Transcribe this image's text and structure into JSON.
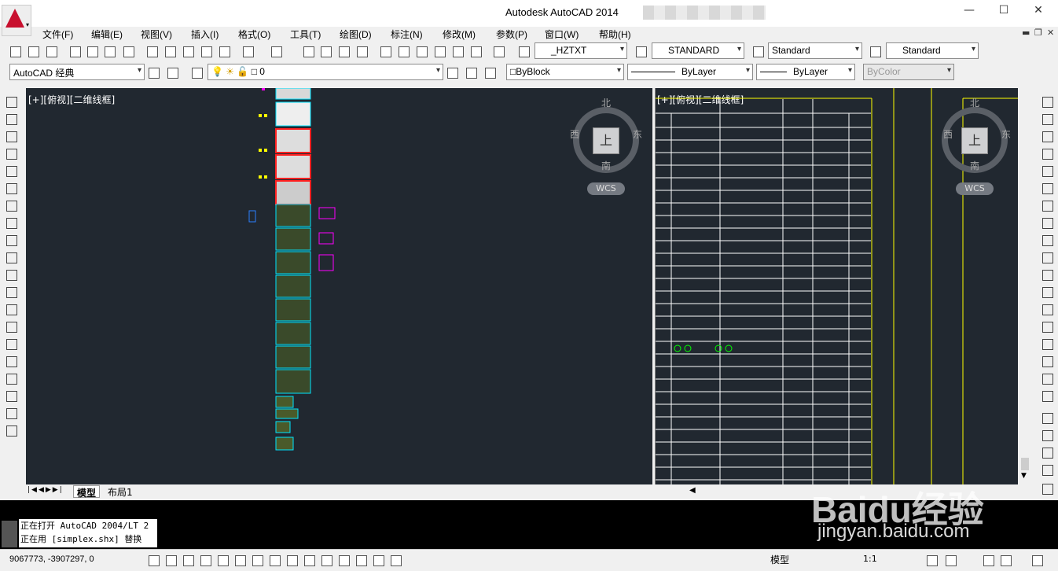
{
  "title": "Autodesk AutoCAD 2014",
  "menu": [
    "文件(F)",
    "编辑(E)",
    "视图(V)",
    "插入(I)",
    "格式(O)",
    "工具(T)",
    "绘图(D)",
    "标注(N)",
    "修改(M)",
    "参数(P)",
    "窗口(W)",
    "帮助(H)"
  ],
  "toolbar": {
    "text_style": "_HZTXT",
    "dim_style": "STANDARD",
    "table_style": "Standard",
    "mleader_style": "Standard",
    "workspace": "AutoCAD 经典",
    "layer": "0",
    "color": "ByBlock",
    "linetype": "ByLayer",
    "lineweight": "ByLayer",
    "plotstyle": "ByColor"
  },
  "viewport_left": {
    "label": "[+][俯视][二维线框]",
    "compass": {
      "north": "北",
      "south": "南",
      "east": "东",
      "west": "西",
      "face": "上",
      "wcs": "WCS"
    }
  },
  "viewport_right": {
    "label": "[+][俯视][二维线框]",
    "compass": {
      "north": "北",
      "south": "南",
      "east": "东",
      "west": "西",
      "face": "上",
      "wcs": "WCS"
    }
  },
  "tabs": [
    "模型",
    "布局1"
  ],
  "command_lines": [
    "正在打开 AutoCAD 2004/LT 2",
    "正在用 [simplex.shx] 替换"
  ],
  "status": {
    "coords": "9067773, -3907297, 0",
    "model": "模型",
    "scale": "1:1"
  },
  "watermark": {
    "line1": "Baidu经验",
    "line2": "jingyan.baidu.com"
  },
  "colors": {
    "canvas": "#212830",
    "accent_red": "#c8102e",
    "cyan": "#00e5ff",
    "magenta": "#ff00ff",
    "yellow": "#ffff00",
    "green": "#00ff00"
  }
}
